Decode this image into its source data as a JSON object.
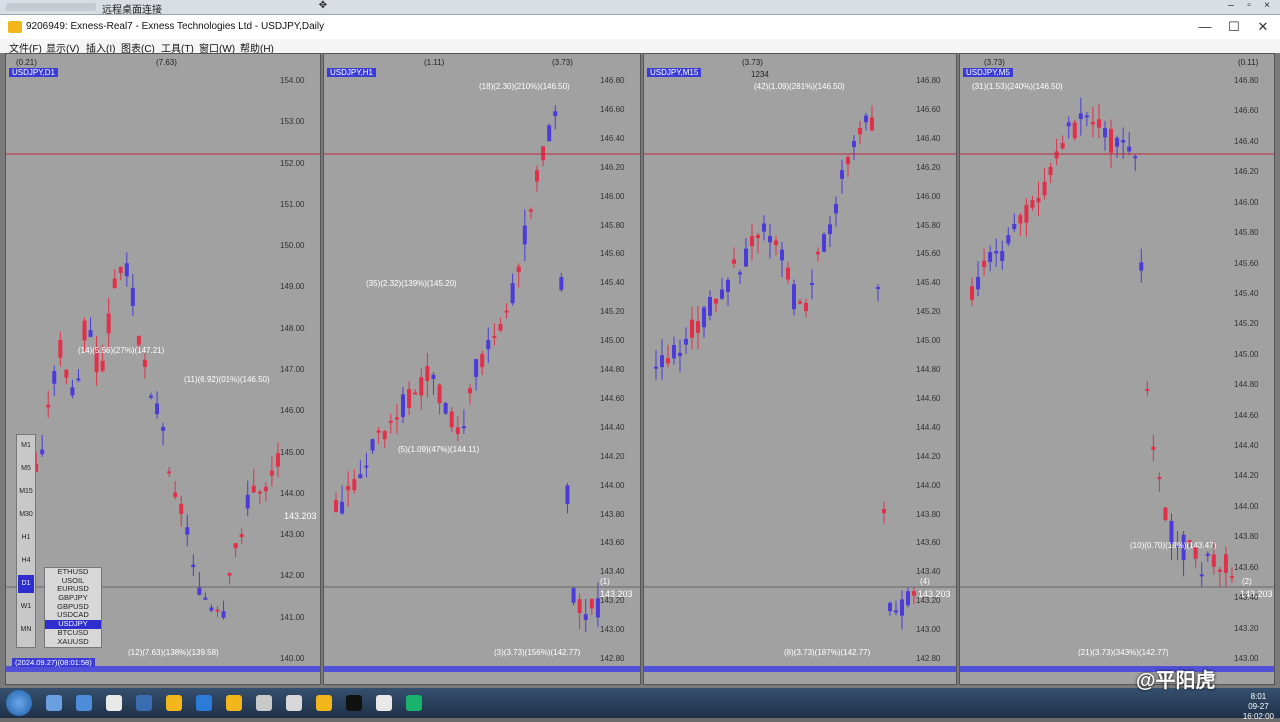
{
  "remote_desktop": {
    "title": "远程桌面连接"
  },
  "window": {
    "title": "9206949: Exness-Real7 - Exness Technologies Ltd - USDJPY,Daily",
    "minimize": "—",
    "maximize": "☐",
    "close": "✕"
  },
  "menu": [
    "文件(F)",
    "显示(V)",
    "插入(I)",
    "图表(C)",
    "工具(T)",
    "窗口(W)",
    "帮助(H)"
  ],
  "charts": [
    {
      "symbol": "USDJPY,D1",
      "top_left": "(0.21)",
      "top_mid": "(7.63)",
      "prices": [
        "154.00",
        "153.00",
        "152.00",
        "151.00",
        "150.00",
        "149.00",
        "148.00",
        "147.00",
        "146.00",
        "145.00",
        "144.00",
        "143.00",
        "142.00",
        "141.00",
        "140.00"
      ],
      "current": "143.203",
      "ann1": "(11)(6.92)(01%)(146.50)",
      "ann2": "(14)(5.56)(27%)(147.21)",
      "ann3": "(12)(7.63)(138%)(139.58)",
      "date": "(2024.09.27)(08:01:58)"
    },
    {
      "symbol": "USDJPY,H1",
      "top_left": "(1.11)",
      "top_mid": "(3.73)",
      "prices": [
        "146.80",
        "146.60",
        "146.40",
        "146.20",
        "146.00",
        "145.80",
        "145.60",
        "145.40",
        "145.20",
        "145.00",
        "144.80",
        "144.60",
        "144.40",
        "144.20",
        "144.00",
        "143.80",
        "143.60",
        "143.40",
        "143.20",
        "143.00",
        "142.80"
      ],
      "current": "143.203",
      "ann1": "(18)(2.30)(210%)(146.50)",
      "ann2": "(35)(2.32)(139%)(145.20)",
      "ann3": "(5)(1.09)(47%)(144.11)",
      "ann4": "(3)(3.73)(156%)(142.77)",
      "count": "(1)"
    },
    {
      "symbol": "USDJPY,M15",
      "top_left": "(3.73)",
      "top_mid": "1234",
      "prices": [
        "146.80",
        "146.60",
        "146.40",
        "146.20",
        "146.00",
        "145.80",
        "145.60",
        "145.40",
        "145.20",
        "145.00",
        "144.80",
        "144.60",
        "144.40",
        "144.20",
        "144.00",
        "143.80",
        "143.60",
        "143.40",
        "143.20",
        "143.00",
        "142.80"
      ],
      "current": "143.203",
      "ann1": "(42)(1.09)(281%)(146.50)",
      "ann2": "(8)(3.73)(187%)(142.77)",
      "count": "(4)"
    },
    {
      "symbol": "USDJPY,M5",
      "top_left": "(3.73)",
      "top_mid": "(0.11)",
      "prices": [
        "146.80",
        "146.60",
        "146.40",
        "146.20",
        "146.00",
        "145.80",
        "145.60",
        "145.40",
        "145.20",
        "145.00",
        "144.80",
        "144.60",
        "144.40",
        "144.20",
        "144.00",
        "143.80",
        "143.60",
        "143.40",
        "143.20",
        "143.00"
      ],
      "current": "143.203",
      "ann1": "(31)(1.53)(240%)(146.50)",
      "ann2": "(10)(0.70)(19%)(143.47)",
      "ann3": "(21)(3.73)(343%)(142.77)",
      "count": "(2)"
    }
  ],
  "timeframes": [
    "M1",
    "M5",
    "M15",
    "M30",
    "H1",
    "H4",
    "D1",
    "W1",
    "MN"
  ],
  "symbols": [
    "ETHUSD",
    "USOIL",
    "EURUSD",
    "GBPJPY",
    "GBPUSD",
    "USDCAD",
    "USDJPY",
    "BTCUSD",
    "XAUUSD"
  ],
  "selected_symbol": "USDJPY",
  "watermark": "@平阳虎",
  "clock": {
    "time": "8:01",
    "date": "09-27",
    "sub": "16:02:00"
  },
  "colors": {
    "bull": "#4b3bd8",
    "bear": "#e0304a",
    "bg": "#a1a1a1",
    "accent": "#3b3bd6"
  }
}
